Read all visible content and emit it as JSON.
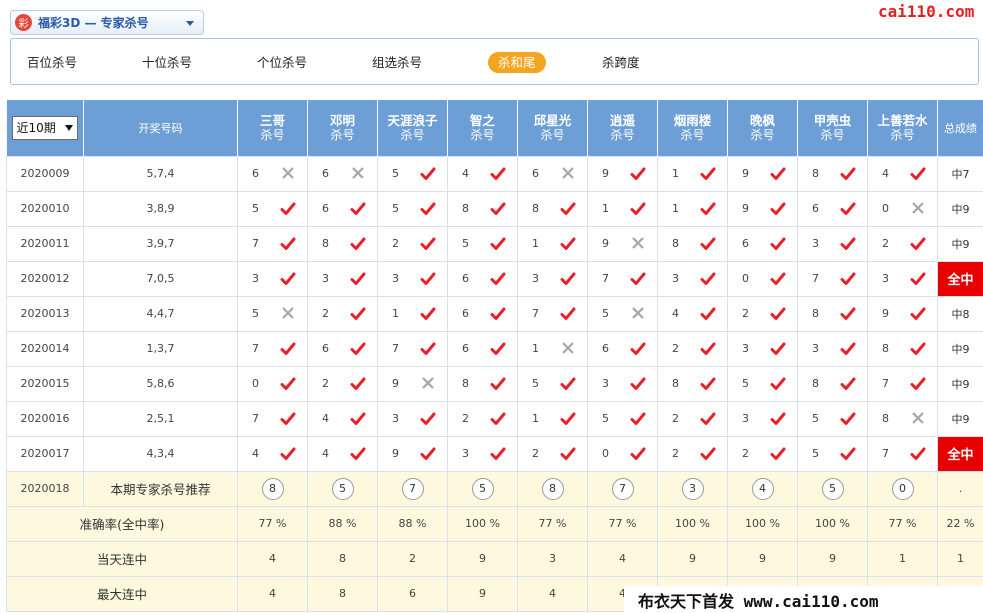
{
  "header": {
    "lottery_logo": "彩",
    "lottery_select": "福彩3D — 专家杀号",
    "site_brand": "cai110.com"
  },
  "tabs": [
    {
      "label": "百位杀号",
      "active": false
    },
    {
      "label": "十位杀号",
      "active": false
    },
    {
      "label": "个位杀号",
      "active": false
    },
    {
      "label": "组选杀号",
      "active": false
    },
    {
      "label": "杀和尾",
      "active": true
    },
    {
      "label": "杀跨度",
      "active": false
    }
  ],
  "table": {
    "period_select": "近10期",
    "draw_header": "开奖号码",
    "expert_sub": "杀号",
    "total_header": "总成绩",
    "experts": [
      "三哥",
      "邓明",
      "天涯浪子",
      "智之",
      "邱星光",
      "逍遥",
      "烟雨楼",
      "晚枫",
      "甲壳虫",
      "上善若水"
    ],
    "rows": [
      {
        "issue": "2020009",
        "draw": "5,7,4",
        "picks": [
          "6",
          "6",
          "5",
          "4",
          "6",
          "9",
          "1",
          "9",
          "8",
          "4"
        ],
        "hits": [
          false,
          false,
          true,
          true,
          false,
          true,
          true,
          true,
          true,
          true
        ],
        "total": "中7",
        "full": false
      },
      {
        "issue": "2020010",
        "draw": "3,8,9",
        "picks": [
          "5",
          "6",
          "5",
          "8",
          "8",
          "1",
          "1",
          "9",
          "6",
          "0"
        ],
        "hits": [
          true,
          true,
          true,
          true,
          true,
          true,
          true,
          true,
          true,
          false
        ],
        "total": "中9",
        "full": false
      },
      {
        "issue": "2020011",
        "draw": "3,9,7",
        "picks": [
          "7",
          "8",
          "2",
          "5",
          "1",
          "9",
          "8",
          "6",
          "3",
          "2"
        ],
        "hits": [
          true,
          true,
          true,
          true,
          true,
          false,
          true,
          true,
          true,
          true
        ],
        "total": "中9",
        "full": false
      },
      {
        "issue": "2020012",
        "draw": "7,0,5",
        "picks": [
          "3",
          "3",
          "3",
          "6",
          "3",
          "7",
          "3",
          "0",
          "7",
          "3"
        ],
        "hits": [
          true,
          true,
          true,
          true,
          true,
          true,
          true,
          true,
          true,
          true
        ],
        "total": "全中",
        "full": true
      },
      {
        "issue": "2020013",
        "draw": "4,4,7",
        "picks": [
          "5",
          "2",
          "1",
          "6",
          "7",
          "5",
          "4",
          "2",
          "8",
          "9"
        ],
        "hits": [
          false,
          true,
          true,
          true,
          true,
          false,
          true,
          true,
          true,
          true
        ],
        "total": "中8",
        "full": false
      },
      {
        "issue": "2020014",
        "draw": "1,3,7",
        "picks": [
          "7",
          "6",
          "7",
          "6",
          "1",
          "6",
          "2",
          "3",
          "3",
          "8"
        ],
        "hits": [
          true,
          true,
          true,
          true,
          false,
          true,
          true,
          true,
          true,
          true
        ],
        "total": "中9",
        "full": false
      },
      {
        "issue": "2020015",
        "draw": "5,8,6",
        "picks": [
          "0",
          "2",
          "9",
          "8",
          "5",
          "3",
          "8",
          "5",
          "8",
          "7"
        ],
        "hits": [
          true,
          true,
          false,
          true,
          true,
          true,
          true,
          true,
          true,
          true
        ],
        "total": "中9",
        "full": false
      },
      {
        "issue": "2020016",
        "draw": "2,5,1",
        "picks": [
          "7",
          "4",
          "3",
          "2",
          "1",
          "5",
          "2",
          "3",
          "5",
          "8"
        ],
        "hits": [
          true,
          true,
          true,
          true,
          true,
          true,
          true,
          true,
          true,
          false
        ],
        "total": "中9",
        "full": false
      },
      {
        "issue": "2020017",
        "draw": "4,3,4",
        "picks": [
          "4",
          "4",
          "9",
          "3",
          "2",
          "0",
          "2",
          "2",
          "5",
          "7"
        ],
        "hits": [
          true,
          true,
          true,
          true,
          true,
          true,
          true,
          true,
          true,
          true
        ],
        "total": "全中",
        "full": true
      }
    ],
    "recommend": {
      "issue": "2020018",
      "label": "本期专家杀号推荐",
      "balls": [
        "8",
        "5",
        "7",
        "5",
        "8",
        "7",
        "3",
        "4",
        "5",
        "0"
      ],
      "total": "."
    },
    "stats": [
      {
        "label": "准确率(全中率)",
        "values": [
          "77 %",
          "88 %",
          "88 %",
          "100 %",
          "77 %",
          "77 %",
          "100 %",
          "100 %",
          "100 %",
          "77 %"
        ],
        "total": "22 %"
      },
      {
        "label": "当天连中",
        "values": [
          "4",
          "8",
          "2",
          "9",
          "3",
          "4",
          "9",
          "9",
          "9",
          "1"
        ],
        "total": "1"
      },
      {
        "label": "最大连中",
        "values": [
          "4",
          "8",
          "6",
          "9",
          "4",
          "4",
          "",
          "",
          "",
          ""
        ],
        "total": ""
      }
    ]
  },
  "watermark": "布衣天下首发 www.cai110.com",
  "colors": {
    "hit": "#e8202a",
    "miss": "#a8a8a8",
    "header": "#6d9fd6",
    "full": "#e60000",
    "active_tab": "#f3a51f"
  },
  "icons": {
    "hit": "check-icon",
    "miss": "cross-icon"
  }
}
